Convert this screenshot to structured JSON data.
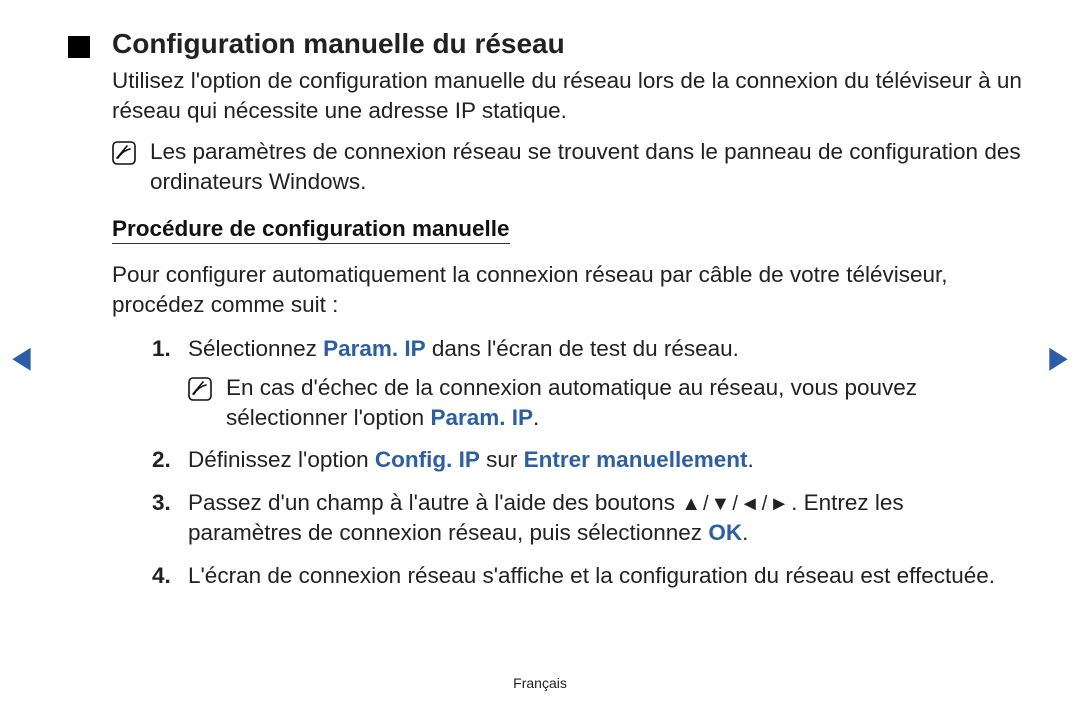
{
  "title": "Configuration manuelle du réseau",
  "intro": "Utilisez l'option de configuration manuelle du réseau lors de la connexion du téléviseur à un réseau qui nécessite une adresse IP statique.",
  "note1": "Les paramètres de connexion réseau se trouvent dans le panneau de configuration des ordinateurs Windows.",
  "subhead": "Procédure de configuration manuelle",
  "sub_intro": "Pour configurer automatiquement la connexion réseau par câble de votre téléviseur, procédez comme suit :",
  "steps": {
    "s1": {
      "num": "1.",
      "pre": "Sélectionnez ",
      "hl": "Param. IP",
      "post": " dans l'écran de test du réseau.",
      "note_pre": "En cas d'échec de la connexion automatique au réseau, vous pouvez sélectionner l'option ",
      "note_hl": "Param. IP",
      "note_post": "."
    },
    "s2": {
      "num": "2.",
      "pre": "Définissez l'option ",
      "hl1": "Config. IP",
      "mid": " sur ",
      "hl2": "Entrer manuellement",
      "post": "."
    },
    "s3": {
      "num": "3.",
      "pre": "Passez d'un champ à l'autre à l'aide des boutons ",
      "arrows": "▲/▼/◄/►",
      "mid": ". Entrez les paramètres de connexion réseau, puis sélectionnez ",
      "ok": "OK",
      "post": "."
    },
    "s4": {
      "num": "4.",
      "text": "L'écran de connexion réseau s'affiche et la configuration du réseau est effectuée."
    }
  },
  "nav": {
    "left": "◀",
    "right": "▶"
  },
  "footer": "Français"
}
